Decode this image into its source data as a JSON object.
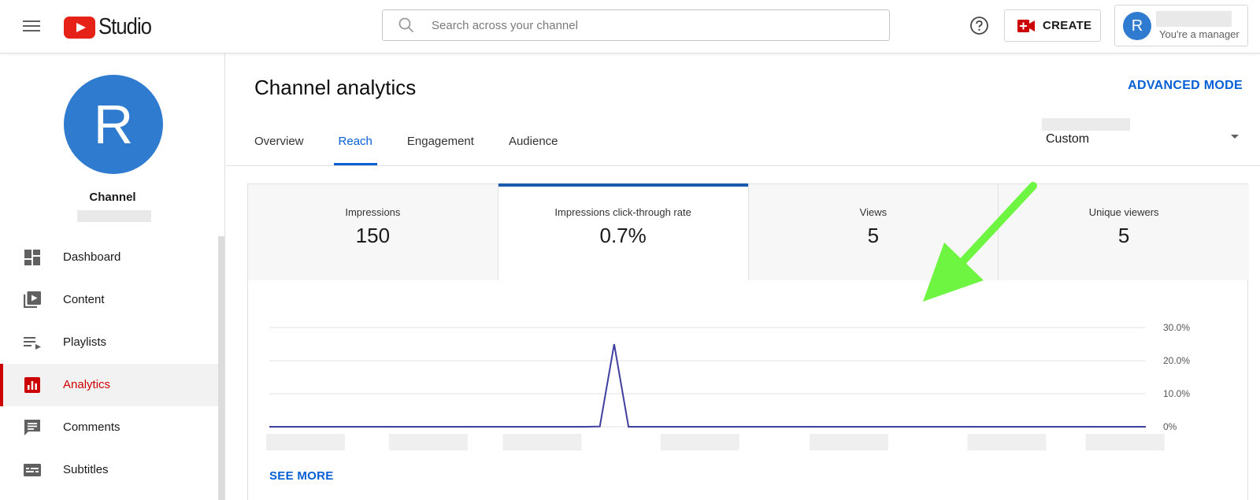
{
  "header": {
    "logo_text": "Studio",
    "search_placeholder": "Search across your channel",
    "create_label": "CREATE",
    "account": {
      "avatar_letter": "R",
      "role": "You're a manager"
    }
  },
  "sidebar": {
    "channel_avatar_letter": "R",
    "channel_label": "Channel",
    "items": [
      {
        "label": "Dashboard",
        "icon": "dashboard-icon",
        "active": false
      },
      {
        "label": "Content",
        "icon": "content-icon",
        "active": false
      },
      {
        "label": "Playlists",
        "icon": "playlists-icon",
        "active": false
      },
      {
        "label": "Analytics",
        "icon": "analytics-icon",
        "active": true
      },
      {
        "label": "Comments",
        "icon": "comments-icon",
        "active": false
      },
      {
        "label": "Subtitles",
        "icon": "subtitles-icon",
        "active": false
      }
    ]
  },
  "main": {
    "title": "Channel analytics",
    "advanced_mode": "ADVANCED MODE",
    "tabs": [
      {
        "label": "Overview",
        "active": false
      },
      {
        "label": "Reach",
        "active": true
      },
      {
        "label": "Engagement",
        "active": false
      },
      {
        "label": "Audience",
        "active": false
      }
    ],
    "date_range": "Custom",
    "metrics": [
      {
        "label": "Impressions",
        "value": "150",
        "active": false
      },
      {
        "label": "Impressions click-through rate",
        "value": "0.7%",
        "active": true
      },
      {
        "label": "Views",
        "value": "5",
        "active": false
      },
      {
        "label": "Unique viewers",
        "value": "5",
        "active": false
      }
    ],
    "see_more": "SEE MORE"
  },
  "colors": {
    "accent_blue": "#065fd4",
    "active_red": "#cc0000",
    "line_color": "#3f3f9f",
    "arrow_green": "#6ef542"
  },
  "chart_data": {
    "type": "line",
    "title": "",
    "xlabel": "",
    "ylabel": "",
    "ylim": [
      0,
      30
    ],
    "y_ticks": [
      "30.0%",
      "20.0%",
      "10.0%",
      "0%"
    ],
    "grid": true,
    "series": [
      {
        "values": [
          0,
          0,
          0,
          0,
          0,
          0,
          0,
          0,
          0,
          0,
          0,
          0,
          0,
          0,
          0,
          0,
          0,
          0,
          0,
          0,
          0,
          0,
          0,
          0.1,
          25,
          0,
          0,
          0,
          0,
          0,
          0,
          0,
          0,
          0,
          0,
          0,
          0,
          0,
          0,
          0,
          0,
          0,
          0,
          0,
          0,
          0,
          0,
          0,
          0,
          0,
          0,
          0,
          0,
          0,
          0,
          0,
          0,
          0,
          0,
          0,
          0,
          0
        ]
      }
    ]
  }
}
